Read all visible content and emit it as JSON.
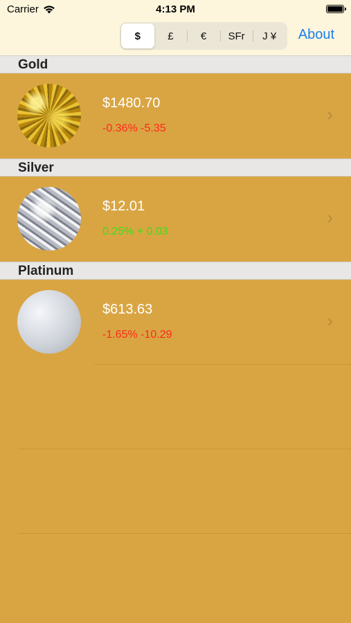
{
  "status_bar": {
    "carrier": "Carrier",
    "time": "4:13 PM"
  },
  "currency_segments": [
    {
      "label": "$",
      "selected": true
    },
    {
      "label": "£",
      "selected": false
    },
    {
      "label": "€",
      "selected": false
    },
    {
      "label": "SFr",
      "selected": false
    },
    {
      "label": "J ¥",
      "selected": false
    }
  ],
  "nav": {
    "about_label": "About"
  },
  "metals": [
    {
      "name": "Gold",
      "price": "$1480.70",
      "change": "-0.36% -5.35",
      "direction": "down",
      "thumb": "gold-texture"
    },
    {
      "name": "Silver",
      "price": "$12.01",
      "change": "0.25% + 0.03",
      "direction": "up",
      "thumb": "silver-foil-texture"
    },
    {
      "name": "Platinum",
      "price": "$613.63",
      "change": "-1.65% -10.29",
      "direction": "down",
      "thumb": "platinum-texture"
    }
  ],
  "colors": {
    "background": "#d9a543",
    "down": "#ff2a1a",
    "up": "#3fdd1a",
    "link": "#1a7ef0"
  }
}
